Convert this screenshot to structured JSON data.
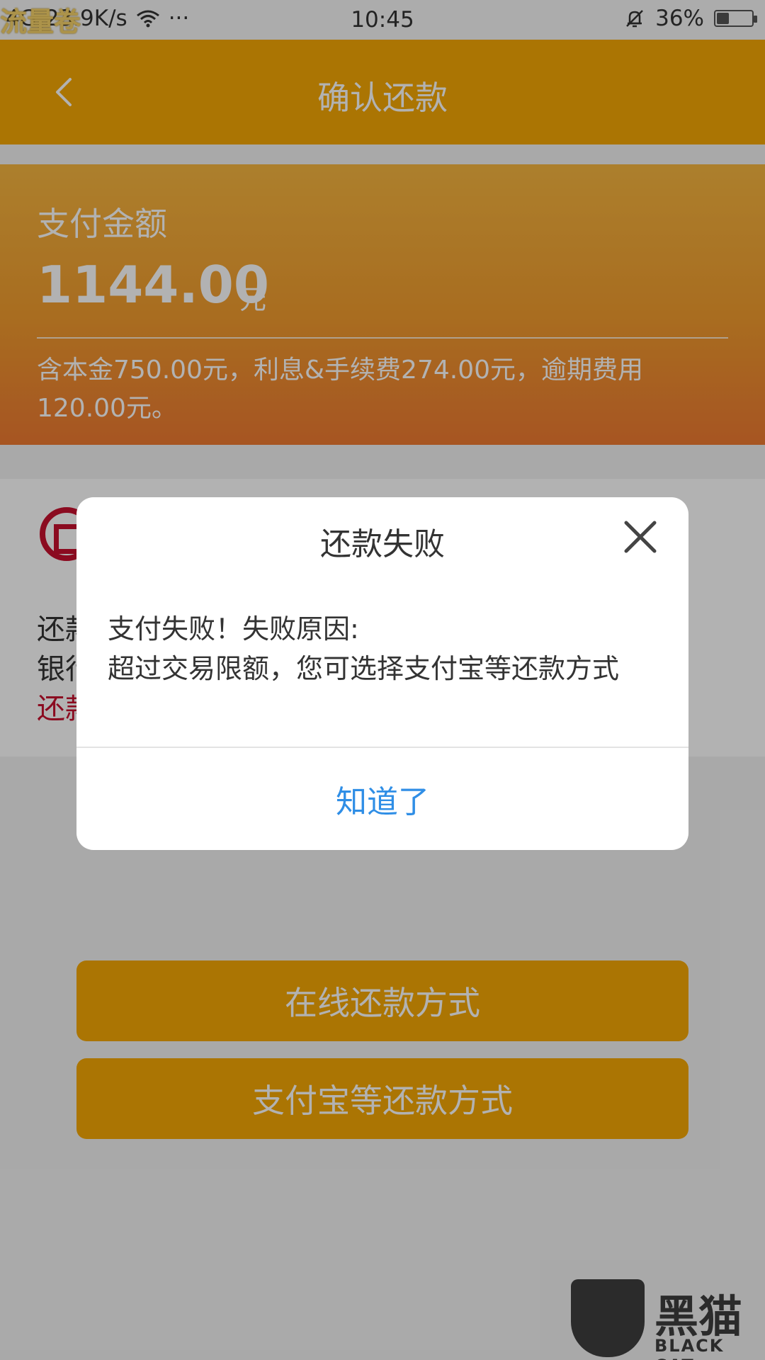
{
  "status_bar": {
    "signal": "4G",
    "speed": "23.9K/s",
    "more": "···",
    "time": "10:45",
    "battery": "36%",
    "battery_level": 0.36,
    "watermark": "流量卷"
  },
  "header": {
    "title": "确认还款"
  },
  "amount": {
    "label": "支付金额",
    "value": "1144.00",
    "unit": "元",
    "detail": "含本金750.00元，利息&手续费274.00元，逾期费用120.00元。"
  },
  "bank": {
    "line1": "还款",
    "line2": "银行",
    "line3": "还款"
  },
  "buttons": {
    "online": "在线还款方式",
    "alipay": "支付宝等还款方式"
  },
  "dialog": {
    "title": "还款失败",
    "message_line1": "支付失败！失败原因:",
    "message_line2": "超过交易限额，您可选择支付宝等还款方式",
    "ok": "知道了"
  },
  "watermark": {
    "brand": "黑猫",
    "sub": "BLACK CAT"
  },
  "colors": {
    "primary": "#f5a805",
    "link": "#2f8ee6",
    "bank_red": "#c8102e"
  }
}
